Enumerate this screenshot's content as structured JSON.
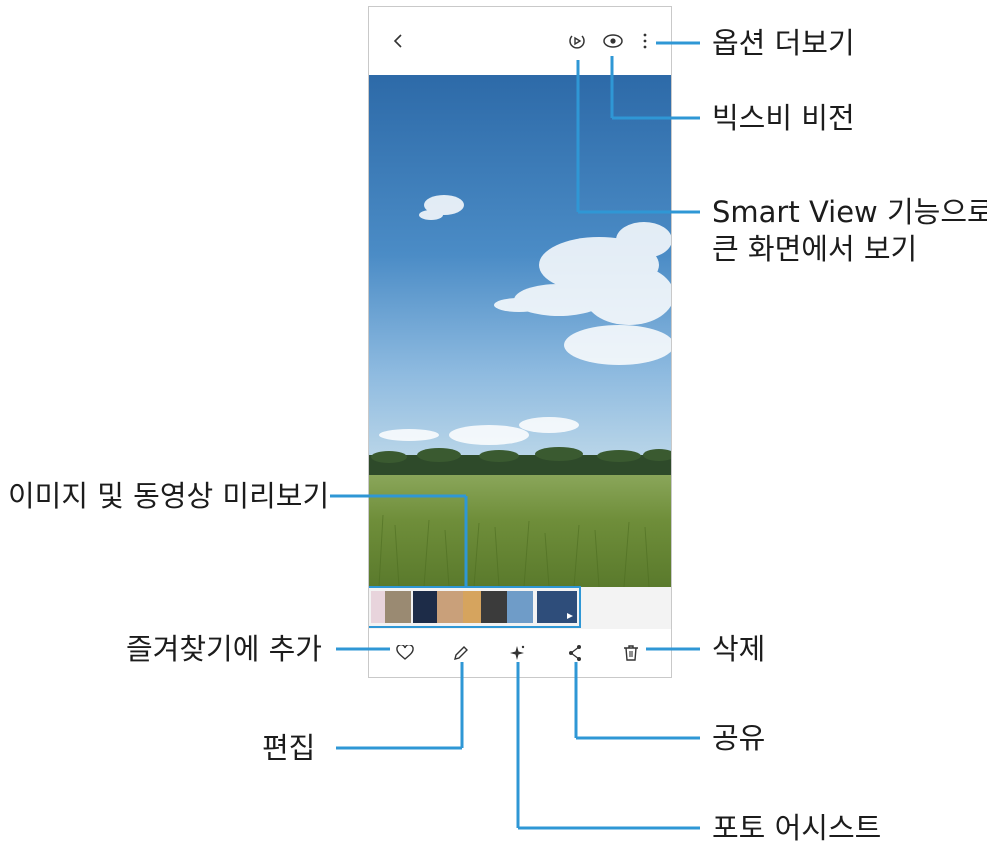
{
  "app": {
    "top_icons": [
      "back-icon",
      "smart-view-icon",
      "bixby-vision-icon",
      "more-options-icon"
    ],
    "bottom_icons": [
      "favorite-icon",
      "edit-icon",
      "photo-assist-icon",
      "share-icon",
      "delete-icon"
    ],
    "preview_thumbnails": [
      "thumb-flowers",
      "thumb-castle",
      "thumb-city-night",
      "thumb-corgi",
      "thumb-shiba",
      "thumb-dog-dark",
      "thumb-field",
      "thumb-video-sunset"
    ]
  },
  "callouts": {
    "more_options": "옵션 더보기",
    "bixby_vision": "빅스비 비전",
    "smart_view_line1": "Smart View 기능으로",
    "smart_view_line2": "큰 화면에서 보기",
    "preview": "이미지 및 동영상 미리보기",
    "favorite": "즐겨찾기에 추가",
    "delete": "삭제",
    "share": "공유",
    "edit": "편집",
    "photo_assist": "포토 어시스트"
  },
  "colors": {
    "callout_line": "#2f97d5",
    "sky_top": "#2d6aa8",
    "grass": "#7a9a3f"
  }
}
